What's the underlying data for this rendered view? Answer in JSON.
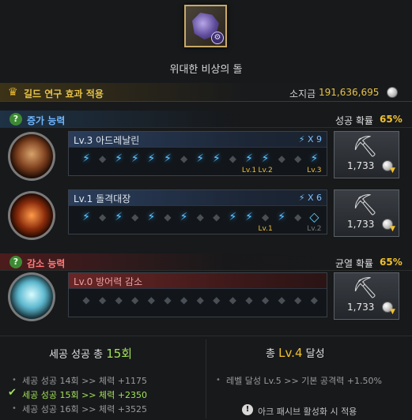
{
  "item": {
    "name": "위대한 비상의 돌",
    "icon": "relic-stone-icon"
  },
  "guild": {
    "label": "길드 연구 효과 적용"
  },
  "money": {
    "label": "소지금",
    "value": "191,636,695"
  },
  "increase": {
    "title": "증가 능력",
    "rate_label": "성공 확률",
    "rate_value": "65%",
    "rows": [
      {
        "name": "Lv.3 아드레날린",
        "mult": "X 9",
        "cost": "1,733",
        "slots": [
          "ok",
          "fail",
          "ok",
          "ok",
          "ok",
          "ok",
          "fail",
          "ok",
          "ok",
          "fail",
          "ok",
          "ok",
          "fail",
          "fail",
          "ok"
        ],
        "lvl_marks": [
          {
            "slot": 10,
            "text": "Lv.1"
          },
          {
            "slot": 11,
            "text": "Lv.2"
          },
          {
            "slot": 14,
            "text": "Lv.3"
          }
        ]
      },
      {
        "name": "Lv.1 돌격대장",
        "mult": "X 6",
        "cost": "1,733",
        "slots": [
          "ok",
          "fail",
          "ok",
          "fail",
          "ok",
          "fail",
          "ok",
          "fail",
          "fail",
          "ok",
          "ok",
          "fail",
          "ok",
          "fail",
          "next"
        ],
        "lvl_marks": [
          {
            "slot": 11,
            "text": "Lv.1"
          },
          {
            "slot": 14,
            "text": "Lv.2"
          }
        ]
      }
    ]
  },
  "decrease": {
    "title": "감소 능력",
    "rate_label": "균열 확률",
    "rate_value": "65%",
    "rows": [
      {
        "name": "Lv.0 방어력 감소",
        "cost": "1,733",
        "slots": [
          "fail",
          "fail",
          "fail",
          "fail",
          "fail",
          "fail",
          "fail",
          "fail",
          "fail",
          "fail",
          "fail",
          "fail",
          "fail",
          "fail",
          "fail"
        ]
      }
    ]
  },
  "summary_left": {
    "title_prefix": "세공 성공 총",
    "title_num": "15회",
    "items": [
      {
        "text": "세공 성공 14회 >> 체력 +1175",
        "current": false
      },
      {
        "text": "세공 성공 15회 >> 체력 +2350",
        "current": true
      },
      {
        "text": "세공 성공 16회 >> 체력 +3525",
        "current": false
      }
    ]
  },
  "summary_right": {
    "title_prefix": "총",
    "title_num": "Lv.4",
    "title_suffix": "달성",
    "items": [
      {
        "text": "레벨 달성 Lv.5 >> 기본 공격력 +1.50%"
      }
    ],
    "note": "아크 패시브 활성화 시 적용"
  },
  "colors": {
    "accent_gold": "#f0c030",
    "success_blue": "#5cc8ff",
    "current_green": "#a3e05a"
  }
}
